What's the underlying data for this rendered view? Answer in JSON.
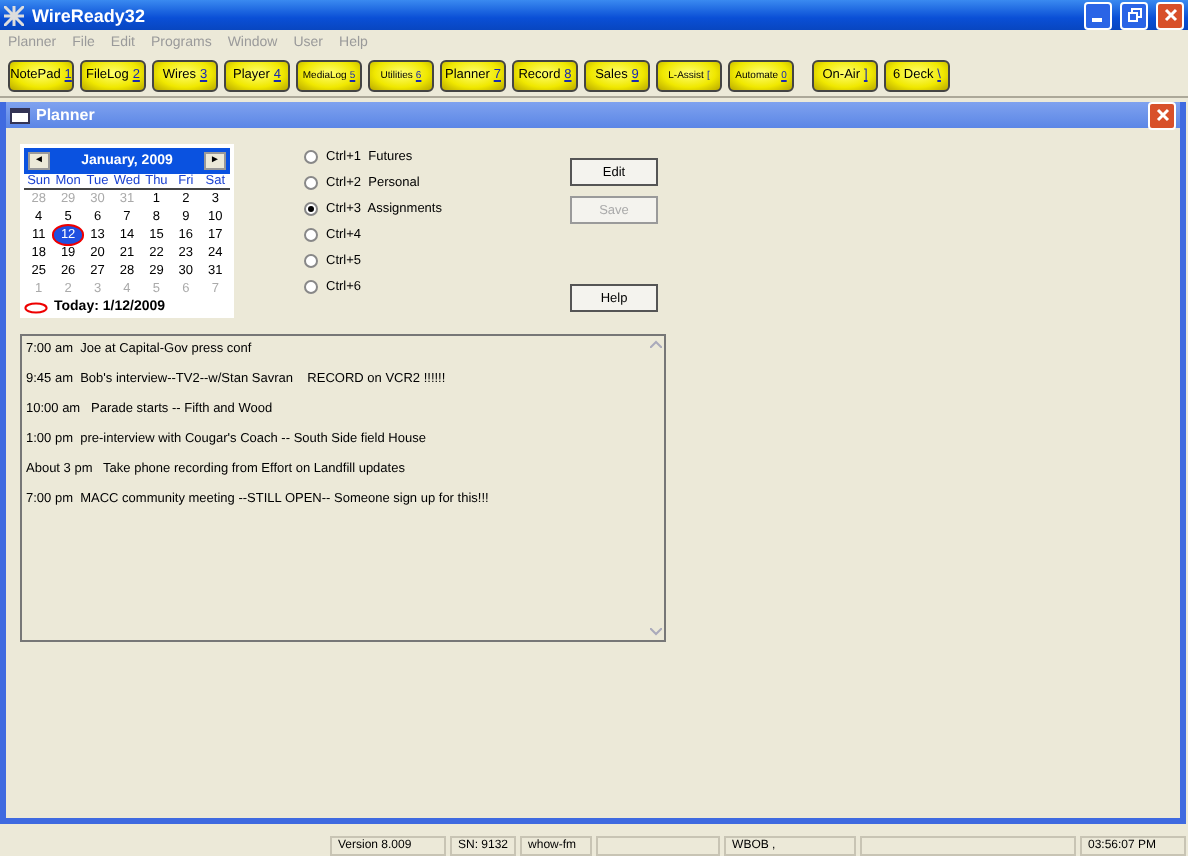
{
  "app": {
    "title": "WireReady32"
  },
  "menu": [
    "Planner",
    "File",
    "Edit",
    "Programs",
    "Window",
    "User",
    "Help"
  ],
  "toolbar": [
    [
      {
        "label": "NotePad",
        "key": "1"
      },
      {
        "label": "FileLog",
        "key": "2"
      },
      {
        "label": "Wires",
        "key": "3"
      },
      {
        "label": "Player",
        "key": "4"
      },
      {
        "label": "MediaLog",
        "key": "5"
      },
      {
        "label": "Utilities",
        "key": "6"
      },
      {
        "label": "Planner",
        "key": "7"
      },
      {
        "label": "Record",
        "key": "8"
      },
      {
        "label": "Sales",
        "key": "9"
      },
      {
        "label": "L-Assist",
        "key": "["
      },
      {
        "label": "Automate",
        "key": "0"
      }
    ],
    [
      {
        "label": "On-Air",
        "key": "]"
      },
      {
        "label": "6 Deck",
        "key": "\\"
      }
    ]
  ],
  "planner": {
    "title": "Planner",
    "calendar": {
      "month": "January, 2009",
      "prev": "◄",
      "next": "►",
      "weekdays": [
        "Sun",
        "Mon",
        "Tue",
        "Wed",
        "Thu",
        "Fri",
        "Sat"
      ],
      "weeks": [
        [
          {
            "day": "28",
            "muted": true,
            "selected": false
          },
          {
            "day": "29",
            "muted": true,
            "selected": false
          },
          {
            "day": "30",
            "muted": true,
            "selected": false
          },
          {
            "day": "31",
            "muted": true,
            "selected": false
          },
          {
            "day": "1",
            "muted": false,
            "selected": false
          },
          {
            "day": "2",
            "muted": false,
            "selected": false
          },
          {
            "day": "3",
            "muted": false,
            "selected": false
          }
        ],
        [
          {
            "day": "4",
            "muted": false,
            "selected": false
          },
          {
            "day": "5",
            "muted": false,
            "selected": false
          },
          {
            "day": "6",
            "muted": false,
            "selected": false
          },
          {
            "day": "7",
            "muted": false,
            "selected": false
          },
          {
            "day": "8",
            "muted": false,
            "selected": false
          },
          {
            "day": "9",
            "muted": false,
            "selected": false
          },
          {
            "day": "10",
            "muted": false,
            "selected": false
          }
        ],
        [
          {
            "day": "11",
            "muted": false,
            "selected": false
          },
          {
            "day": "12",
            "muted": false,
            "selected": true
          },
          {
            "day": "13",
            "muted": false,
            "selected": false
          },
          {
            "day": "14",
            "muted": false,
            "selected": false
          },
          {
            "day": "15",
            "muted": false,
            "selected": false
          },
          {
            "day": "16",
            "muted": false,
            "selected": false
          },
          {
            "day": "17",
            "muted": false,
            "selected": false
          }
        ],
        [
          {
            "day": "18",
            "muted": false,
            "selected": false
          },
          {
            "day": "19",
            "muted": false,
            "selected": false
          },
          {
            "day": "20",
            "muted": false,
            "selected": false
          },
          {
            "day": "21",
            "muted": false,
            "selected": false
          },
          {
            "day": "22",
            "muted": false,
            "selected": false
          },
          {
            "day": "23",
            "muted": false,
            "selected": false
          },
          {
            "day": "24",
            "muted": false,
            "selected": false
          }
        ],
        [
          {
            "day": "25",
            "muted": false,
            "selected": false
          },
          {
            "day": "26",
            "muted": false,
            "selected": false
          },
          {
            "day": "27",
            "muted": false,
            "selected": false
          },
          {
            "day": "28",
            "muted": false,
            "selected": false
          },
          {
            "day": "29",
            "muted": false,
            "selected": false
          },
          {
            "day": "30",
            "muted": false,
            "selected": false
          },
          {
            "day": "31",
            "muted": false,
            "selected": false
          }
        ],
        [
          {
            "day": "1",
            "muted": true,
            "selected": false
          },
          {
            "day": "2",
            "muted": true,
            "selected": false
          },
          {
            "day": "3",
            "muted": true,
            "selected": false
          },
          {
            "day": "4",
            "muted": true,
            "selected": false
          },
          {
            "day": "5",
            "muted": true,
            "selected": false
          },
          {
            "day": "6",
            "muted": true,
            "selected": false
          },
          {
            "day": "7",
            "muted": true,
            "selected": false
          }
        ]
      ],
      "today": "Today: 1/12/2009"
    },
    "categories": [
      {
        "label": "Ctrl+1  Futures",
        "selected": false
      },
      {
        "label": "Ctrl+2  Personal",
        "selected": false
      },
      {
        "label": "Ctrl+3  Assignments",
        "selected": true
      },
      {
        "label": "Ctrl+4",
        "selected": false
      },
      {
        "label": "Ctrl+5",
        "selected": false
      },
      {
        "label": "Ctrl+6",
        "selected": false
      }
    ],
    "buttons": [
      {
        "label": "Edit",
        "disabled": false
      },
      {
        "label": "Save",
        "disabled": true
      },
      {
        "label": "Help",
        "disabled": false
      }
    ],
    "notes": [
      "7:00 am  Joe at Capital-Gov press conf",
      "9:45 am  Bob's interview--TV2--w/Stan Savran    RECORD on VCR2 !!!!!!",
      "10:00 am   Parade starts -- Fifth and Wood",
      "1:00 pm  pre-interview with Cougar's Coach -- South Side field House",
      "About 3 pm   Take phone recording from Effort on Landfill updates",
      "7:00 pm  MACC community meeting --STILL OPEN-- Someone sign up for this!!!"
    ]
  },
  "status_bar": [
    {
      "kind": "text",
      "text": "Version 8.009"
    },
    {
      "kind": "text",
      "text": "SN: 9132"
    },
    {
      "kind": "text",
      "text": "whow-fm"
    },
    {
      "kind": "blank"
    },
    {
      "kind": "text",
      "text": "WBOB   ,"
    },
    {
      "kind": "spacer"
    },
    {
      "kind": "text",
      "text": "03:56:07 PM"
    }
  ]
}
